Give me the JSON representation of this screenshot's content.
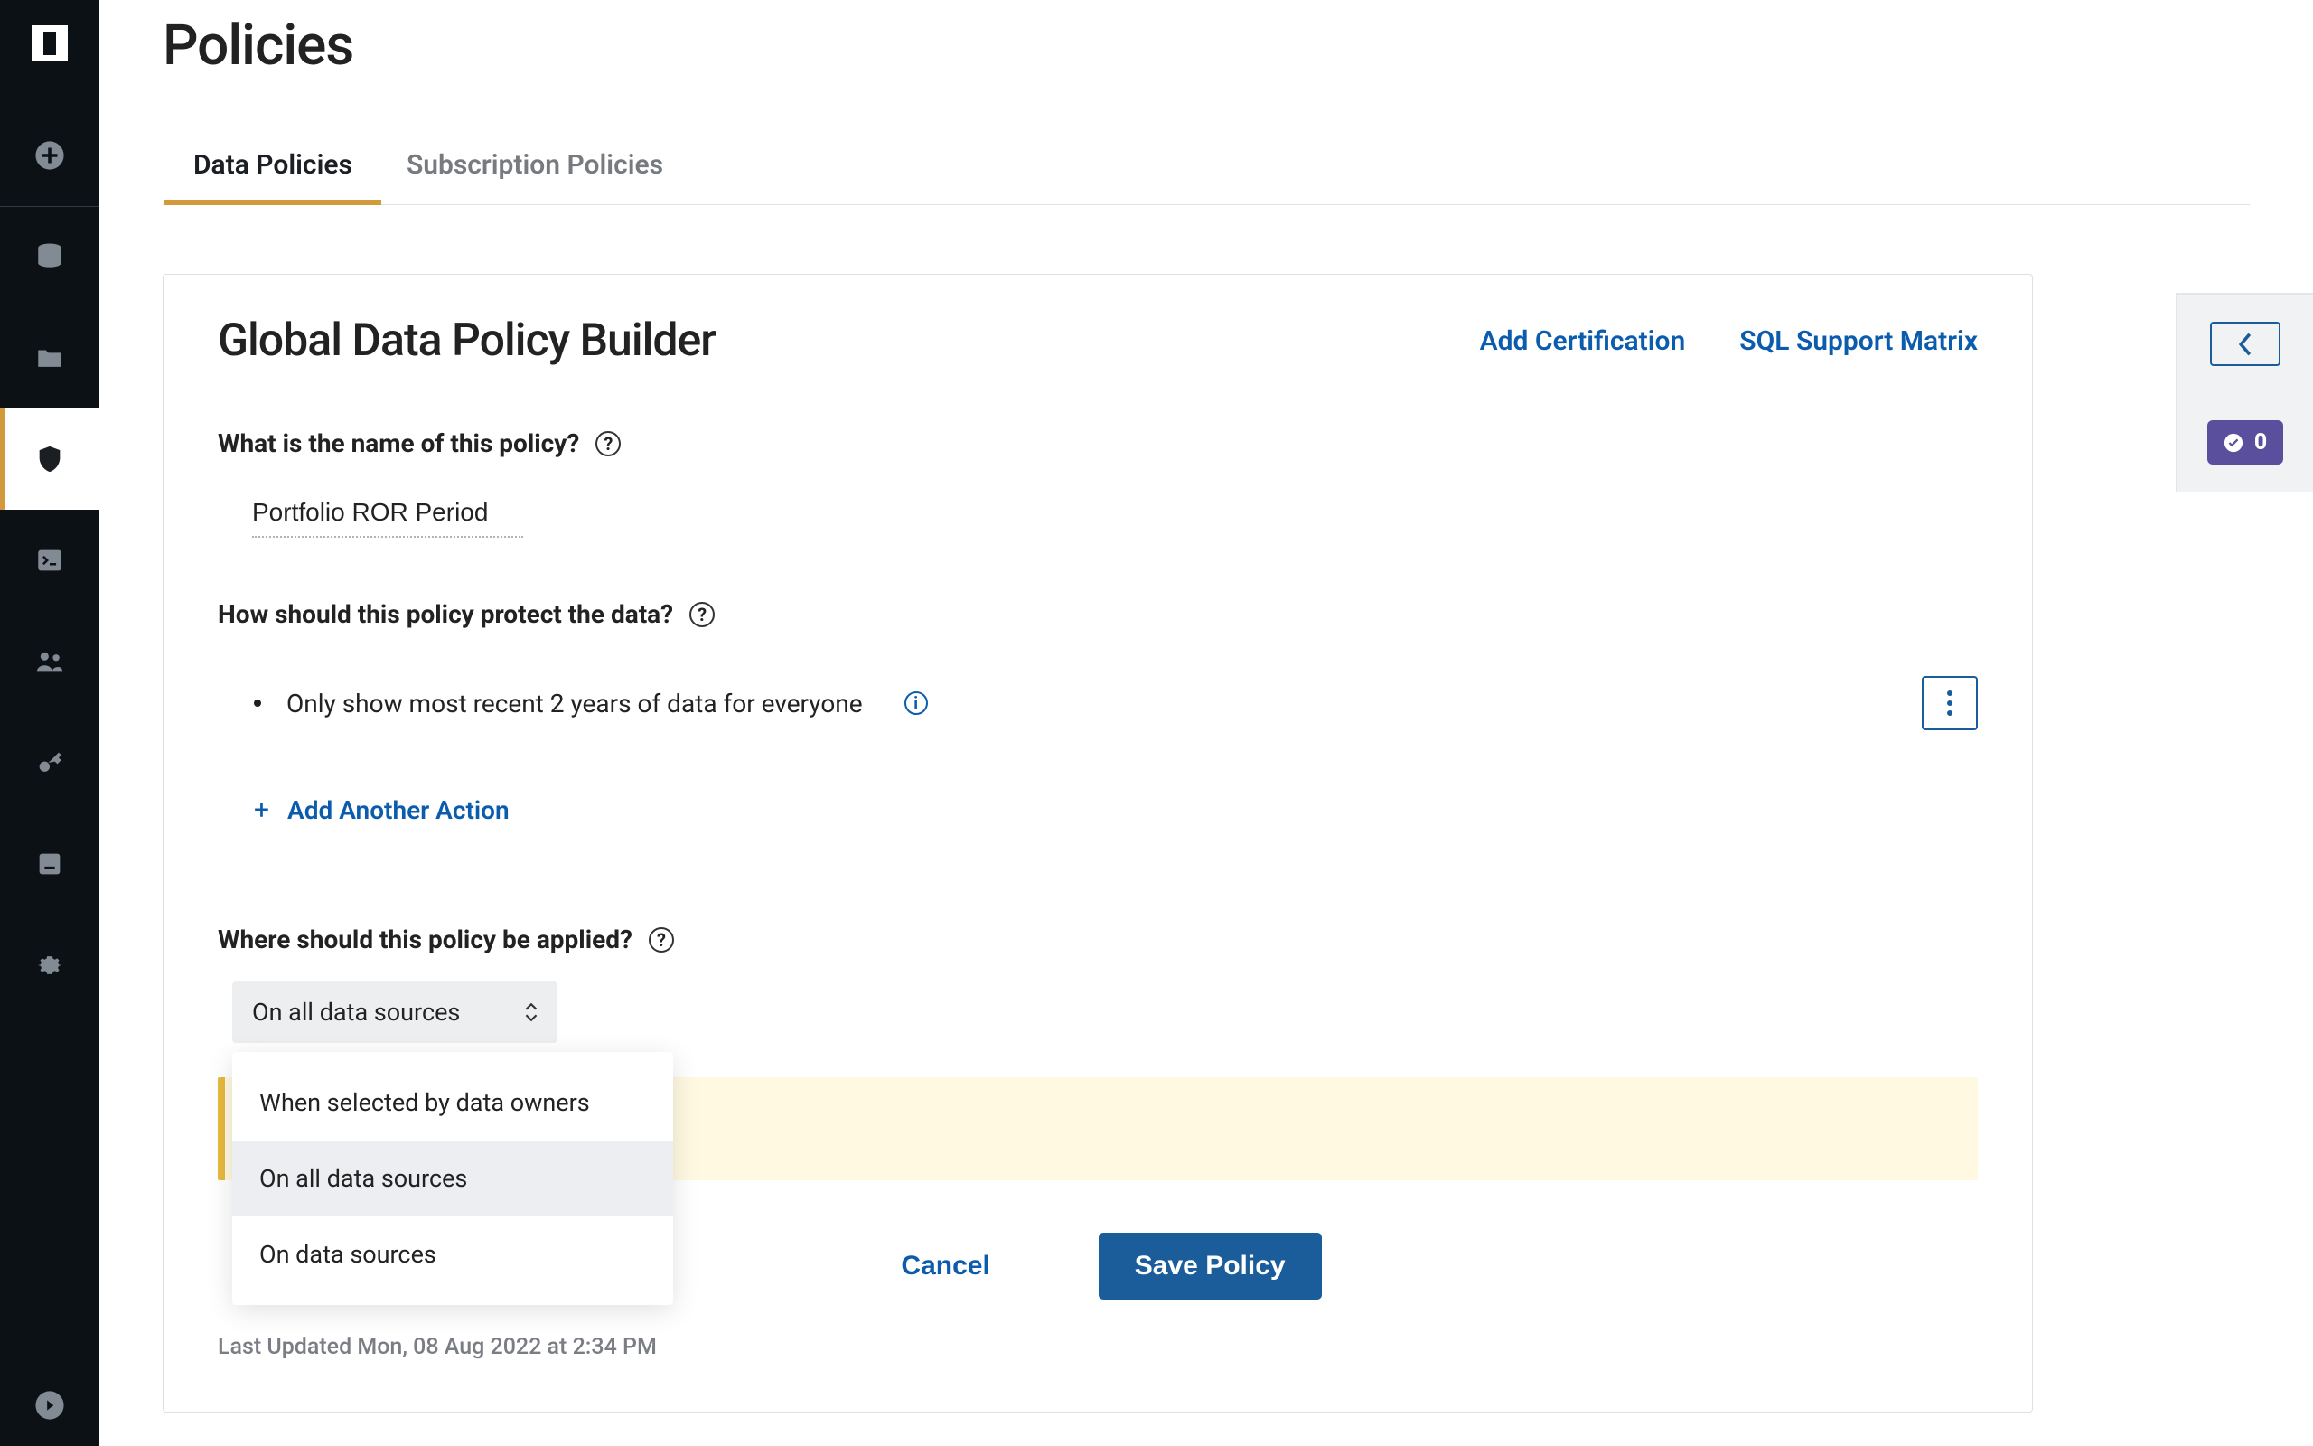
{
  "sidebar": {
    "items": [
      "logo",
      "add",
      "database",
      "folder",
      "shield",
      "console",
      "people",
      "key",
      "archive",
      "gear",
      "arrow"
    ]
  },
  "page": {
    "title": "Policies"
  },
  "tabs": [
    {
      "label": "Data Policies",
      "active": true
    },
    {
      "label": "Subscription Policies",
      "active": false
    }
  ],
  "builder": {
    "title": "Global Data Policy Builder",
    "links": {
      "add_certification": "Add Certification",
      "sql_support_matrix": "SQL Support Matrix"
    },
    "name_question": "What is the name of this policy?",
    "name_value": "Portfolio ROR Period",
    "protect_question": "How should this policy protect the data?",
    "rule_text": "Only show most recent 2 years of data for everyone",
    "add_action_label": "Add Another Action",
    "where_question": "Where should this policy be applied?",
    "where_selected": "On all data sources",
    "where_options": [
      "When selected by data owners",
      "On all data sources",
      "On data sources"
    ],
    "cancel_label": "Cancel",
    "save_label": "Save Policy",
    "last_updated": "Last Updated Mon, 08 Aug 2022 at 2:34 PM"
  },
  "right_rail": {
    "badge_count": "0"
  }
}
